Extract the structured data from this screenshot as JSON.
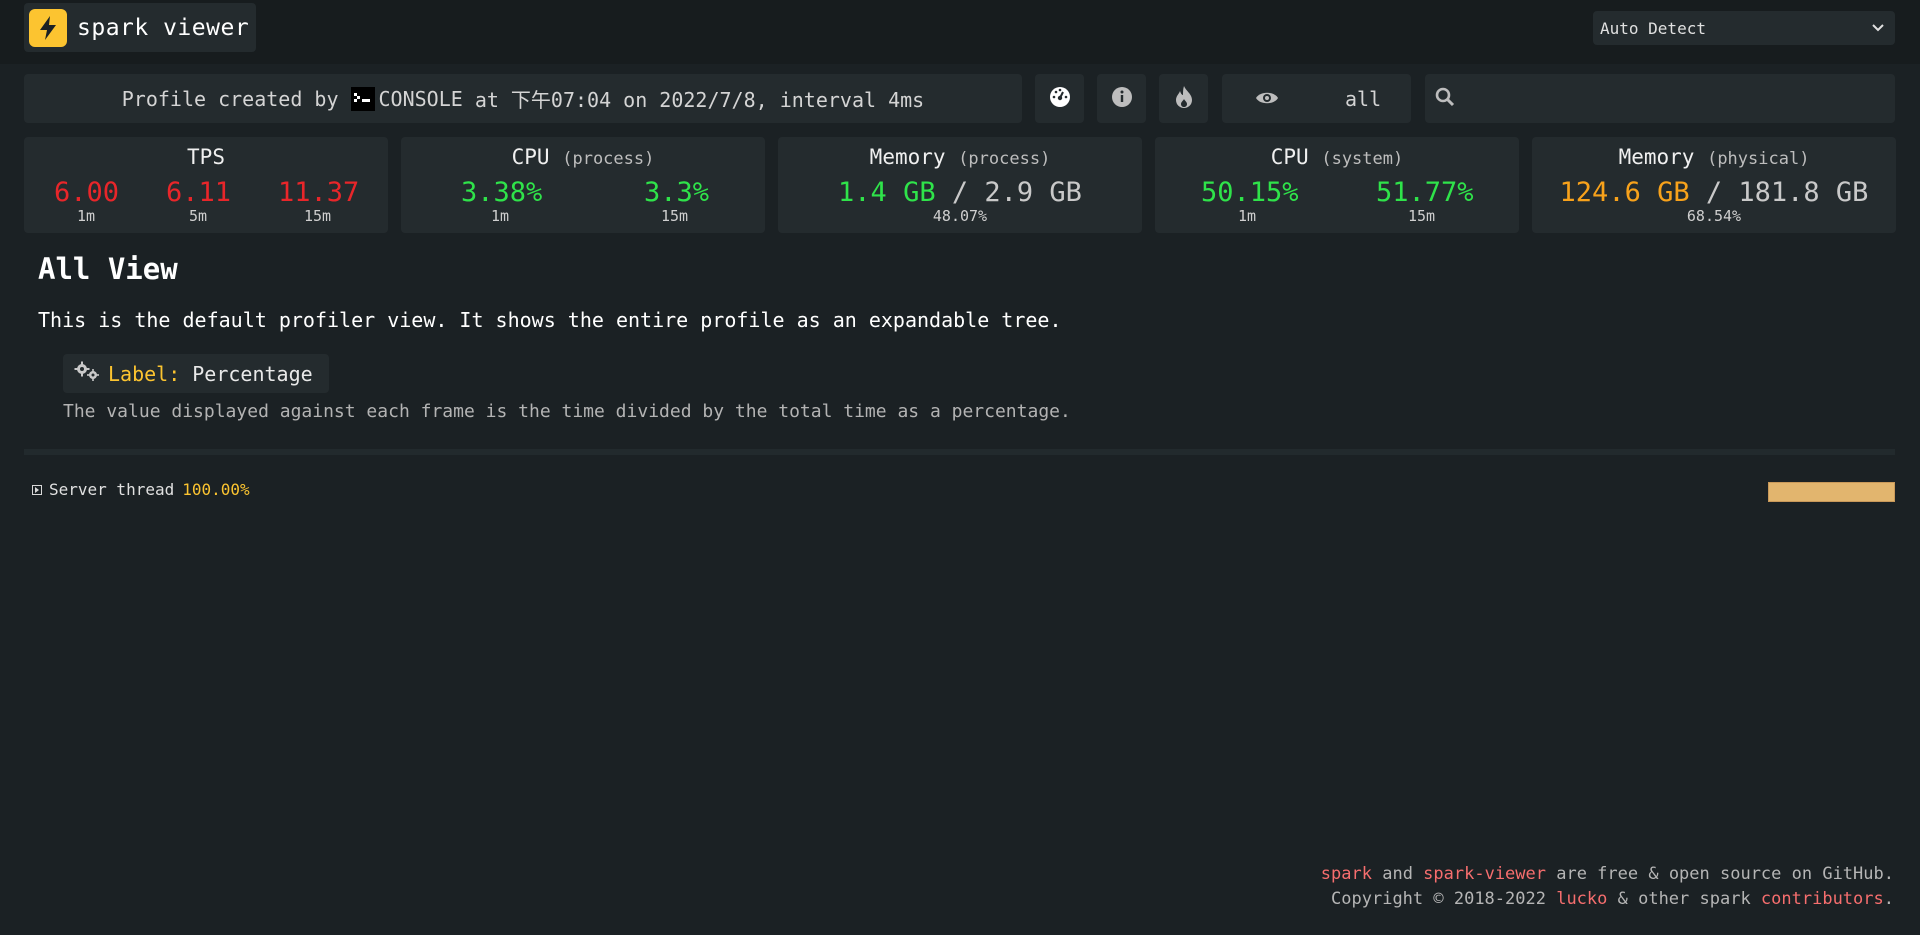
{
  "app": {
    "title": "spark viewer"
  },
  "platform_select": {
    "value": "Auto Detect"
  },
  "profile_info": {
    "prefix": "Profile created by",
    "creator": "CONSOLE",
    "middle": "at 下午07:04 on 2022/7/8, interval 4ms"
  },
  "toolbar": {
    "icons": [
      "dashboard-icon",
      "info-icon",
      "flame-icon"
    ],
    "view_mode_label": "all",
    "search_placeholder": ""
  },
  "stats": {
    "tps": {
      "title": "TPS",
      "values": [
        "6.00",
        "6.11",
        "11.37"
      ],
      "labels": [
        "1m",
        "5m",
        "15m"
      ]
    },
    "cpu_process": {
      "title": "CPU",
      "sub": "(process)",
      "values": [
        "3.38%",
        "3.3%"
      ],
      "labels": [
        "1m",
        "15m"
      ]
    },
    "memory_process": {
      "title": "Memory",
      "sub": "(process)",
      "used": "1.4 GB",
      "sep": "/",
      "total": "2.9 GB",
      "percent": "48.07%"
    },
    "cpu_system": {
      "title": "CPU",
      "sub": "(system)",
      "values": [
        "50.15%",
        "51.77%"
      ],
      "labels": [
        "1m",
        "15m"
      ]
    },
    "memory_physical": {
      "title": "Memory",
      "sub": "(physical)",
      "used": "124.6 GB",
      "sep": "/",
      "total": "181.8 GB",
      "percent": "68.54%"
    }
  },
  "view": {
    "title": "All View",
    "description": "This is the default profiler view. It shows the entire profile as an expandable tree.",
    "label_key": "Label:",
    "label_value": "Percentage",
    "label_description": "The value displayed against each frame is the time divided by the total time as a percentage."
  },
  "tree": {
    "items": [
      {
        "name": "Server thread",
        "percent": "100.00%",
        "fill": 1.0
      }
    ]
  },
  "footer": {
    "line1_link1": "spark",
    "line1_and": " and ",
    "line1_link2": "spark-viewer",
    "line1_rest": " are free & open source on GitHub.",
    "line2_prefix": "Copyright © 2018-2022 ",
    "line2_link1": "lucko",
    "line2_mid": " & other spark ",
    "line2_link2": "contributors",
    "line2_end": "."
  },
  "colors": {
    "background": "#1b2124",
    "panel": "#242b2e",
    "accent_yellow": "#fcc430",
    "red": "#e8262a",
    "green": "#2fe34a",
    "orange": "#f8a21b",
    "link": "#f66e6e",
    "bar": "#e2b56e"
  }
}
